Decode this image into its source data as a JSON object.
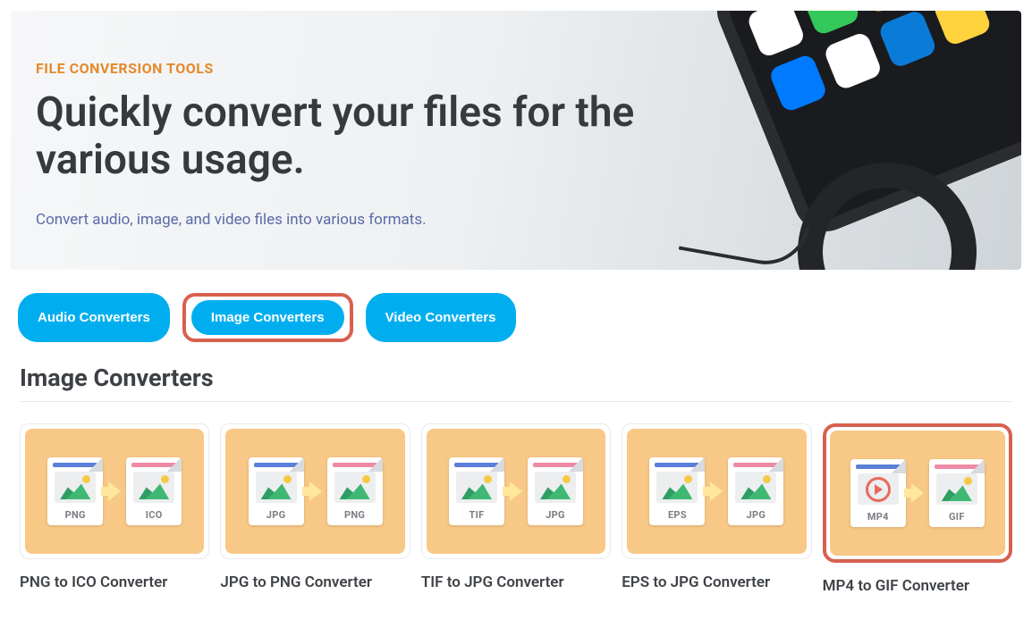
{
  "hero": {
    "eyebrow": "FILE CONVERSION TOOLS",
    "title": "Quickly convert your files for the various usage.",
    "subtitle": "Convert audio, image, and video files into various formats."
  },
  "tabs": [
    {
      "label": "Audio Converters",
      "highlighted": false
    },
    {
      "label": "Image Converters",
      "highlighted": true
    },
    {
      "label": "Video Converters",
      "highlighted": false
    }
  ],
  "section_title": "Image Converters",
  "converters": [
    {
      "from": "PNG",
      "to": "ICO",
      "title": "PNG to ICO Converter",
      "from_stripe": "blue",
      "to_stripe": "pink",
      "from_play": false,
      "highlighted": false
    },
    {
      "from": "JPG",
      "to": "PNG",
      "title": "JPG to PNG Converter",
      "from_stripe": "blue",
      "to_stripe": "pink",
      "from_play": false,
      "highlighted": false
    },
    {
      "from": "TIF",
      "to": "JPG",
      "title": "TIF to JPG Converter",
      "from_stripe": "blue",
      "to_stripe": "pink",
      "from_play": false,
      "highlighted": false
    },
    {
      "from": "EPS",
      "to": "JPG",
      "title": "EPS to JPG Converter",
      "from_stripe": "blue",
      "to_stripe": "pink",
      "from_play": false,
      "highlighted": false
    },
    {
      "from": "MP4",
      "to": "GIF",
      "title": "MP4 to GIF Converter",
      "from_stripe": "blue",
      "to_stripe": "pink",
      "from_play": true,
      "highlighted": true
    }
  ]
}
